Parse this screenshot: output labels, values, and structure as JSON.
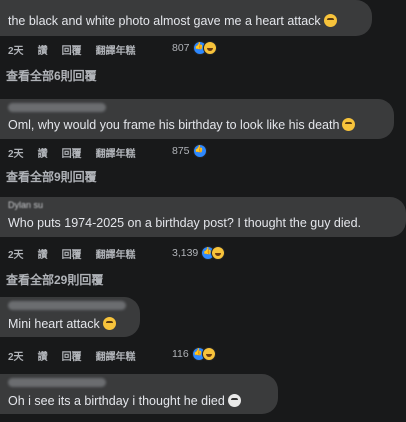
{
  "action_labels": {
    "time": "2天",
    "like": "讚",
    "reply": "回覆",
    "translate": "翻譯年糕"
  },
  "comments": [
    {
      "name": "",
      "text": "the black and white photo almost gave me a heart attack",
      "emoji": "face-anxious-sweat-emoji",
      "reaction_count": "807",
      "reactions": [
        "like",
        "haha"
      ],
      "view_replies": "查看全部6則回覆"
    },
    {
      "name": "",
      "text": "Oml, why would you frame his birthday to look like his death",
      "emoji": "face-anxious-sweat-emoji",
      "reaction_count": "875",
      "reactions": [
        "like"
      ],
      "view_replies": "查看全部9則回覆"
    },
    {
      "name": "Dylan su",
      "text": "Who puts 1974-2025 on a birthday post? I thought the guy died.",
      "emoji": "",
      "reaction_count": "3,139",
      "reactions": [
        "like",
        "haha"
      ],
      "view_replies": "查看全部29則回覆"
    },
    {
      "name": "",
      "text": "Mini heart attack",
      "emoji": "grimacing-face-emoji",
      "reaction_count": "116",
      "reactions": [
        "like",
        "haha"
      ],
      "view_replies": ""
    },
    {
      "name": "",
      "text": "Oh i see its a birthday i thought he died",
      "emoji": "skull-emoji",
      "reaction_count": "",
      "reactions": [],
      "view_replies": ""
    }
  ]
}
